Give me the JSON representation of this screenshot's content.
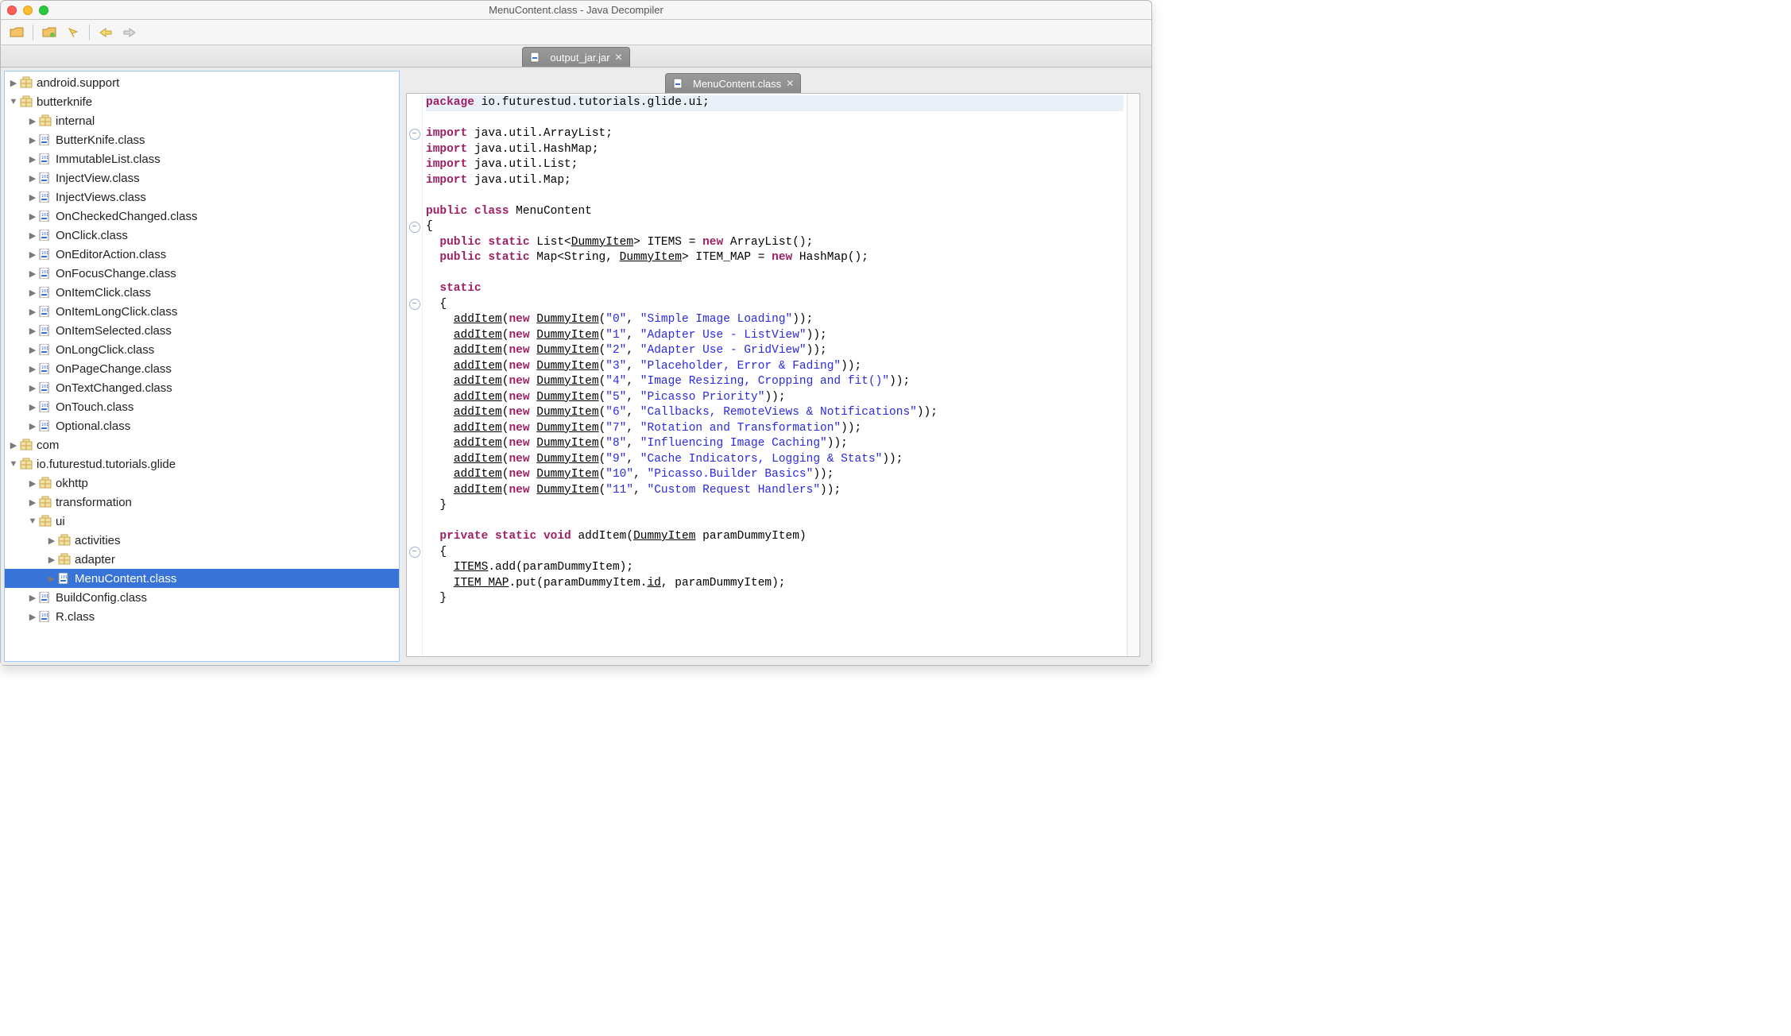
{
  "window": {
    "title": "MenuContent.class - Java Decompiler"
  },
  "file_tab": {
    "label": "output_jar.jar"
  },
  "editor_tab": {
    "label": "MenuContent.class"
  },
  "tree": {
    "n0": "android.support",
    "n1": "butterknife",
    "n1_0": "internal",
    "n1_1": "ButterKnife.class",
    "n1_2": "ImmutableList.class",
    "n1_3": "InjectView.class",
    "n1_4": "InjectViews.class",
    "n1_5": "OnCheckedChanged.class",
    "n1_6": "OnClick.class",
    "n1_7": "OnEditorAction.class",
    "n1_8": "OnFocusChange.class",
    "n1_9": "OnItemClick.class",
    "n1_10": "OnItemLongClick.class",
    "n1_11": "OnItemSelected.class",
    "n1_12": "OnLongClick.class",
    "n1_13": "OnPageChange.class",
    "n1_14": "OnTextChanged.class",
    "n1_15": "OnTouch.class",
    "n1_16": "Optional.class",
    "n2": "com",
    "n3": "io.futurestud.tutorials.glide",
    "n3_0": "okhttp",
    "n3_1": "transformation",
    "n3_2": "ui",
    "n3_2_0": "activities",
    "n3_2_1": "adapter",
    "n3_2_2": "MenuContent.class",
    "n3_3": "BuildConfig.class",
    "n3_4": "R.class"
  },
  "code": {
    "pkg_kw": "package",
    "pkg": " io.futurestud.tutorials.glide.ui;",
    "imp_kw": "import",
    "imp1": " java.util.ArrayList;",
    "imp2": " java.util.HashMap;",
    "imp3": " java.util.List;",
    "imp4": " java.util.Map;",
    "public_kw": "public",
    "class_kw": "class",
    "className": " MenuContent",
    "static_kw": "static",
    "new_kw": "new",
    "void_kw": "void",
    "private_kw": "private",
    "field1_a": "  public static ",
    "field1_b": "List<",
    "field1_c": "DummyItem",
    "field1_d": "> ITEMS = ",
    "field1_e": " ArrayList();",
    "field2_a": "  public static ",
    "field2_b": "Map<String, ",
    "field2_c": "DummyItem",
    "field2_d": "> ITEM_MAP = ",
    "field2_e": " HashMap();",
    "addItem": "addItem",
    "dummy": "DummyItem",
    "items": [
      {
        "id": "\"0\"",
        "text": "\"Simple Image Loading\""
      },
      {
        "id": "\"1\"",
        "text": "\"Adapter Use - ListView\""
      },
      {
        "id": "\"2\"",
        "text": "\"Adapter Use - GridView\""
      },
      {
        "id": "\"3\"",
        "text": "\"Placeholder, Error & Fading\""
      },
      {
        "id": "\"4\"",
        "text": "\"Image Resizing, Cropping and fit()\""
      },
      {
        "id": "\"5\"",
        "text": "\"Picasso Priority\""
      },
      {
        "id": "\"6\"",
        "text": "\"Callbacks, RemoteViews & Notifications\""
      },
      {
        "id": "\"7\"",
        "text": "\"Rotation and Transformation\""
      },
      {
        "id": "\"8\"",
        "text": "\"Influencing Image Caching\""
      },
      {
        "id": "\"9\"",
        "text": "\"Cache Indicators, Logging & Stats\""
      },
      {
        "id": "\"10\"",
        "text": "\"Picasso.Builder Basics\""
      },
      {
        "id": "\"11\"",
        "text": "\"Custom Request Handlers\""
      }
    ],
    "method_sig_a": "  private static void ",
    "method_sig_b": "addItem(",
    "method_sig_c": "DummyItem",
    "method_sig_d": " paramDummyItem)",
    "body1_a": "    ",
    "body1_b": "ITEMS",
    "body1_c": ".add(paramDummyItem);",
    "body2_a": "    ",
    "body2_b": "ITEM_MAP",
    "body2_c": ".put(paramDummyItem.",
    "body2_d": "id",
    "body2_e": ", paramDummyItem);"
  }
}
